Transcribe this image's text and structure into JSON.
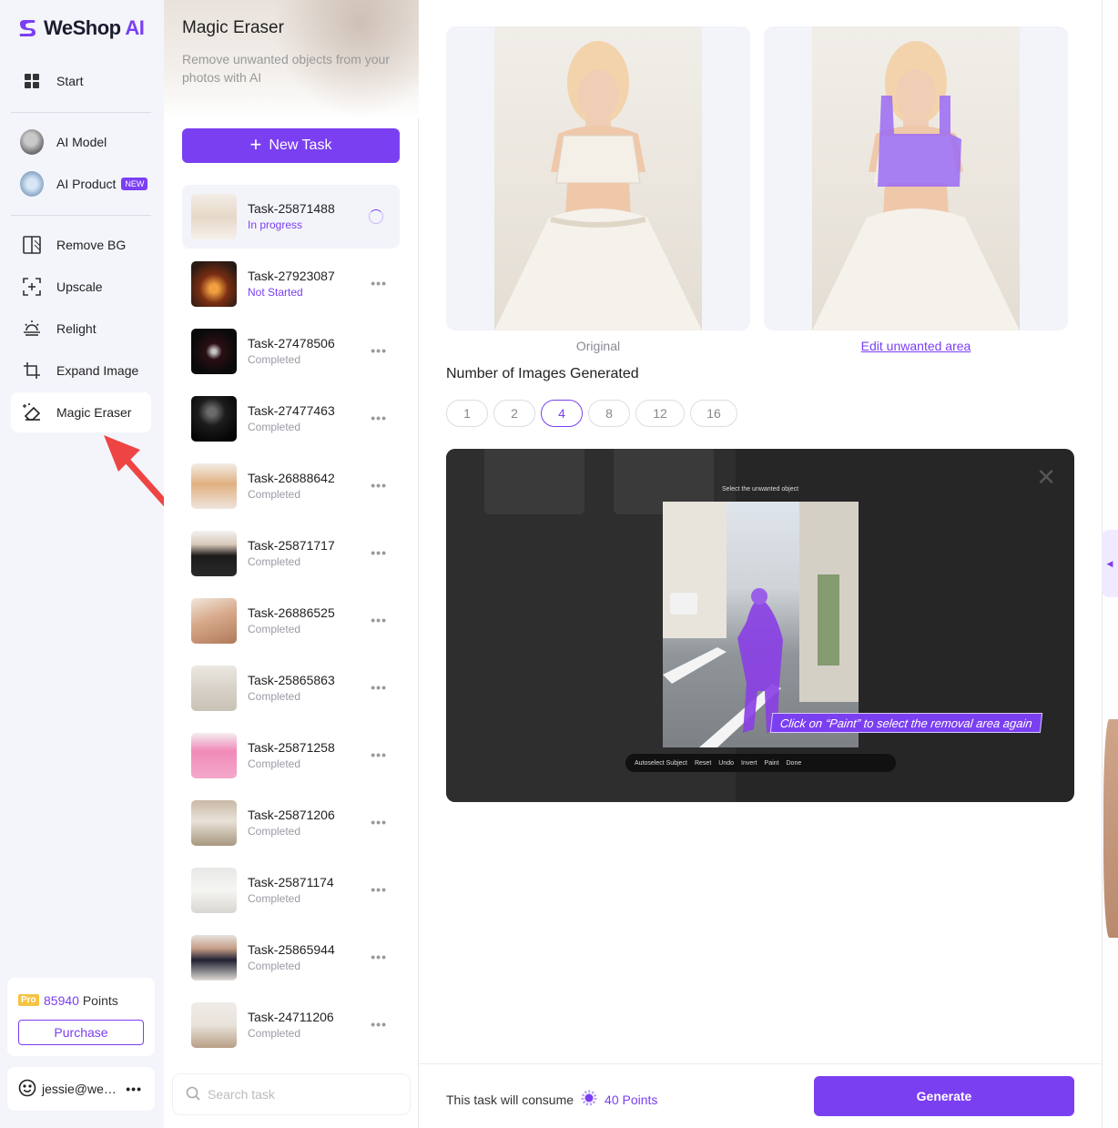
{
  "brand": {
    "name": "WeShop",
    "name_suffix": "AI"
  },
  "nav": {
    "start": "Start",
    "ai_model": "AI Model",
    "ai_product": "AI Product",
    "new_badge": "NEW",
    "remove_bg": "Remove BG",
    "upscale": "Upscale",
    "relight": "Relight",
    "expand_image": "Expand Image",
    "magic_eraser": "Magic Eraser"
  },
  "account": {
    "pro_badge": "Pro",
    "points_value": "85940",
    "points_label": "Points",
    "purchase": "Purchase",
    "email": "jessie@we…",
    "more": "•••"
  },
  "tool": {
    "title": "Magic Eraser",
    "subtitle": "Remove unwanted objects from your photos with AI",
    "new_task": "New Task"
  },
  "tasks": [
    {
      "name": "Task-25871488",
      "status": "In progress"
    },
    {
      "name": "Task-27923087",
      "status": "Not Started"
    },
    {
      "name": "Task-27478506",
      "status": "Completed"
    },
    {
      "name": "Task-27477463",
      "status": "Completed"
    },
    {
      "name": "Task-26888642",
      "status": "Completed"
    },
    {
      "name": "Task-25871717",
      "status": "Completed"
    },
    {
      "name": "Task-26886525",
      "status": "Completed"
    },
    {
      "name": "Task-25865863",
      "status": "Completed"
    },
    {
      "name": "Task-25871258",
      "status": "Completed"
    },
    {
      "name": "Task-25871206",
      "status": "Completed"
    },
    {
      "name": "Task-25871174",
      "status": "Completed"
    },
    {
      "name": "Task-25865944",
      "status": "Completed"
    },
    {
      "name": "Task-24711206",
      "status": "Completed"
    }
  ],
  "task_more": "•••",
  "search": {
    "placeholder": "Search task"
  },
  "main": {
    "original_caption": "Original",
    "edit_link": "Edit unwanted area",
    "count_label": "Number of Images Generated",
    "count_options": [
      "1",
      "2",
      "4",
      "8",
      "12",
      "16"
    ],
    "count_selected": "4"
  },
  "demo": {
    "title": "Select the unwanted object",
    "callout": "Click on “Paint” to select the removal area again",
    "tools": [
      "Autoselect Subject",
      "Reset",
      "Undo",
      "Invert",
      "Paint",
      "Done"
    ],
    "close": "✕"
  },
  "footer": {
    "consume_text": "This task will consume",
    "points": "40 Points",
    "generate": "Generate"
  },
  "colors": {
    "accent": "#7b3ff2",
    "mask": "#9a6bf5",
    "pro": "#f6c343"
  }
}
